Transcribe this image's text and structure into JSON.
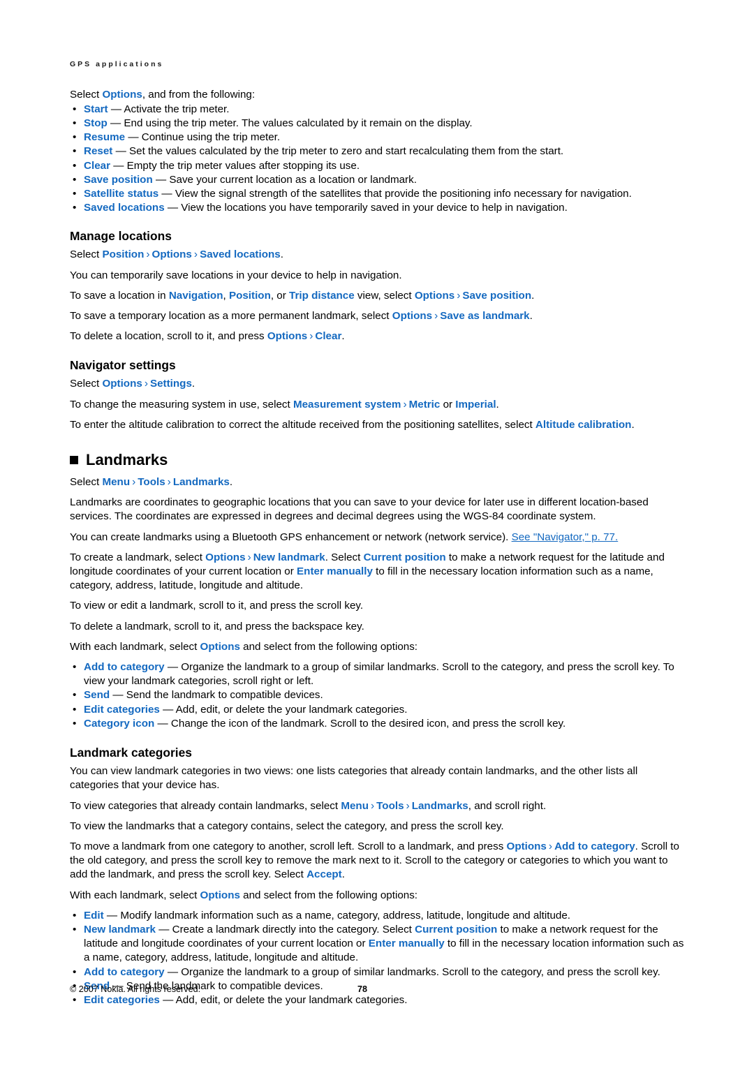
{
  "page": {
    "running_header": "GPS applications",
    "footer_copyright": "© 2007 Nokia. All rights reserved.",
    "page_number": "78",
    "accent_color": "#1469c0",
    "text_color": "#000000",
    "background_color": "#ffffff"
  },
  "intro": {
    "lead": [
      {
        "t": "Select "
      },
      {
        "t": "Options",
        "ui": true
      },
      {
        "t": ", and from the following:"
      }
    ],
    "bullets": [
      [
        {
          "t": "Start",
          "ui": true
        },
        {
          "t": " — Activate the trip meter."
        }
      ],
      [
        {
          "t": "Stop",
          "ui": true
        },
        {
          "t": " — End using the trip meter. The values calculated by it remain on the display."
        }
      ],
      [
        {
          "t": "Resume",
          "ui": true
        },
        {
          "t": " — Continue using the trip meter."
        }
      ],
      [
        {
          "t": "Reset",
          "ui": true
        },
        {
          "t": " — Set the values calculated by the trip meter to zero and start recalculating them from the start."
        }
      ],
      [
        {
          "t": "Clear",
          "ui": true
        },
        {
          "t": " — Empty the trip meter values after stopping its use."
        }
      ],
      [
        {
          "t": "Save position",
          "ui": true
        },
        {
          "t": " — Save your current location as a location or landmark."
        }
      ],
      [
        {
          "t": "Satellite status",
          "ui": true
        },
        {
          "t": " — View the signal strength of the satellites that provide the positioning info necessary for navigation."
        }
      ],
      [
        {
          "t": "Saved locations",
          "ui": true
        },
        {
          "t": " — View the locations you have temporarily saved in your device to help in navigation."
        }
      ]
    ]
  },
  "manage_locations": {
    "heading": "Manage locations",
    "paragraphs": [
      [
        {
          "t": "Select "
        },
        {
          "t": "Position",
          "ui": true
        },
        {
          "chev": true
        },
        {
          "t": "Options",
          "ui": true
        },
        {
          "chev": true
        },
        {
          "t": "Saved locations",
          "ui": true
        },
        {
          "t": "."
        }
      ],
      [
        {
          "t": "You can temporarily save locations in your device to help in navigation."
        }
      ],
      [
        {
          "t": "To save a location in "
        },
        {
          "t": "Navigation",
          "ui": true
        },
        {
          "t": ", "
        },
        {
          "t": "Position",
          "ui": true
        },
        {
          "t": ", or "
        },
        {
          "t": "Trip distance",
          "ui": true
        },
        {
          "t": " view, select "
        },
        {
          "t": "Options",
          "ui": true
        },
        {
          "chev": true
        },
        {
          "t": "Save position",
          "ui": true
        },
        {
          "t": "."
        }
      ],
      [
        {
          "t": "To save a temporary location as a more permanent landmark, select "
        },
        {
          "t": "Options",
          "ui": true
        },
        {
          "chev": true
        },
        {
          "t": "Save as landmark",
          "ui": true
        },
        {
          "t": "."
        }
      ],
      [
        {
          "t": "To delete a location, scroll to it, and press "
        },
        {
          "t": "Options",
          "ui": true
        },
        {
          "chev": true
        },
        {
          "t": "Clear",
          "ui": true
        },
        {
          "t": "."
        }
      ]
    ]
  },
  "navigator_settings": {
    "heading": "Navigator settings",
    "paragraphs": [
      [
        {
          "t": "Select "
        },
        {
          "t": "Options",
          "ui": true
        },
        {
          "chev": true
        },
        {
          "t": "Settings",
          "ui": true
        },
        {
          "t": "."
        }
      ],
      [
        {
          "t": "To change the measuring system in use, select "
        },
        {
          "t": "Measurement system",
          "ui": true
        },
        {
          "chev": true
        },
        {
          "t": "Metric",
          "ui": true
        },
        {
          "t": " or "
        },
        {
          "t": "Imperial",
          "ui": true
        },
        {
          "t": "."
        }
      ],
      [
        {
          "t": "To enter the altitude calibration to correct the altitude received from the positioning satellites, select "
        },
        {
          "t": "Altitude calibration",
          "ui": true
        },
        {
          "t": "."
        }
      ]
    ]
  },
  "landmarks": {
    "heading": "Landmarks",
    "paragraphs": [
      [
        {
          "t": "Select "
        },
        {
          "t": "Menu",
          "ui": true
        },
        {
          "chev": true
        },
        {
          "t": "Tools",
          "ui": true
        },
        {
          "chev": true
        },
        {
          "t": "Landmarks",
          "ui": true
        },
        {
          "t": "."
        }
      ],
      [
        {
          "t": "Landmarks are coordinates to geographic locations that you can save to your device for later use in different location-based services. The coordinates are expressed in degrees and decimal degrees using the WGS-84 coordinate system."
        }
      ],
      [
        {
          "t": "You can create landmarks using a Bluetooth GPS enhancement or network (network service). "
        },
        {
          "t": "See \"Navigator,\" p. 77.",
          "xref": true
        }
      ],
      [
        {
          "t": "To create a landmark, select "
        },
        {
          "t": "Options",
          "ui": true
        },
        {
          "chev": true
        },
        {
          "t": "New landmark",
          "ui": true
        },
        {
          "t": ". Select "
        },
        {
          "t": "Current position",
          "ui": true
        },
        {
          "t": " to make a network request for the latitude and longitude coordinates of your current location or "
        },
        {
          "t": "Enter manually",
          "ui": true
        },
        {
          "t": " to fill in the necessary location information such as a name, category, address, latitude, longitude and altitude."
        }
      ],
      [
        {
          "t": "To view or edit a landmark, scroll to it, and press the scroll key."
        }
      ],
      [
        {
          "t": "To delete a landmark, scroll to it, and press the backspace key."
        }
      ],
      [
        {
          "t": "With each landmark, select "
        },
        {
          "t": "Options",
          "ui": true
        },
        {
          "t": " and select from the following options:"
        }
      ]
    ],
    "bullets": [
      [
        {
          "t": "Add to category",
          "ui": true
        },
        {
          "t": " — Organize the landmark to a group of similar landmarks. Scroll to the category, and press the scroll key. To view your landmark categories, scroll right or left."
        }
      ],
      [
        {
          "t": "Send",
          "ui": true
        },
        {
          "t": " — Send the landmark to compatible devices."
        }
      ],
      [
        {
          "t": "Edit categories",
          "ui": true
        },
        {
          "t": " — Add, edit, or delete the your landmark categories."
        }
      ],
      [
        {
          "t": "Category icon",
          "ui": true
        },
        {
          "t": " — Change the icon of the landmark. Scroll to the desired icon, and press the scroll key."
        }
      ]
    ]
  },
  "landmark_categories": {
    "heading": "Landmark categories",
    "paragraphs": [
      [
        {
          "t": "You can view landmark categories in two views: one lists categories that already contain landmarks, and the other lists all categories that your device has."
        }
      ],
      [
        {
          "t": "To view categories that already contain landmarks, select "
        },
        {
          "t": "Menu",
          "ui": true
        },
        {
          "chev": true
        },
        {
          "t": "Tools",
          "ui": true
        },
        {
          "chev": true
        },
        {
          "t": "Landmarks",
          "ui": true
        },
        {
          "t": ", and scroll right."
        }
      ],
      [
        {
          "t": "To view the landmarks that a category contains, select the category, and press the scroll key."
        }
      ],
      [
        {
          "t": "To move a landmark from one category to another, scroll left. Scroll to a landmark, and press "
        },
        {
          "t": "Options",
          "ui": true
        },
        {
          "chev": true
        },
        {
          "t": "Add to category",
          "ui": true
        },
        {
          "t": ". Scroll to the old category, and press the scroll key to remove the mark next to it. Scroll to the category or categories to which you want to add the landmark, and press the scroll key. Select "
        },
        {
          "t": "Accept",
          "ui": true
        },
        {
          "t": "."
        }
      ],
      [
        {
          "t": "With each landmark, select "
        },
        {
          "t": "Options",
          "ui": true
        },
        {
          "t": " and select from the following options:"
        }
      ]
    ],
    "bullets": [
      [
        {
          "t": "Edit",
          "ui": true
        },
        {
          "t": " — Modify landmark information such as a name, category, address, latitude, longitude and altitude."
        }
      ],
      [
        {
          "t": "New landmark",
          "ui": true
        },
        {
          "t": " — Create a landmark directly into the category. Select "
        },
        {
          "t": "Current position",
          "ui": true
        },
        {
          "t": " to make a network request for the latitude and longitude coordinates of your current location or "
        },
        {
          "t": "Enter manually",
          "ui": true
        },
        {
          "t": " to fill in the necessary location information such as a name, category, address, latitude, longitude and altitude."
        }
      ],
      [
        {
          "t": "Add to category",
          "ui": true
        },
        {
          "t": " — Organize the landmark to a group of similar landmarks. Scroll to the category, and press the scroll key."
        }
      ],
      [
        {
          "t": "Send",
          "ui": true
        },
        {
          "t": " — Send the landmark to compatible devices."
        }
      ],
      [
        {
          "t": "Edit categories",
          "ui": true
        },
        {
          "t": " — Add, edit, or delete the your landmark categories."
        }
      ]
    ]
  }
}
